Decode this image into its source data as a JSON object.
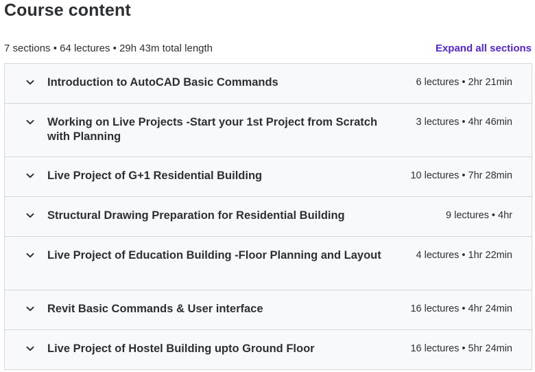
{
  "header": {
    "title": "Course content",
    "summary": "7 sections • 64 lectures • 29h 43m total length",
    "expand_all_label": "Expand all sections"
  },
  "colors": {
    "accent": "#5624d0",
    "section_bg": "#f7f9fa",
    "border": "#d1d7dc",
    "text": "#2d2f31"
  },
  "sections": [
    {
      "title": "Introduction to AutoCAD Basic Commands",
      "meta": "6 lectures • 2hr 21min",
      "icon": "chevron-down-icon"
    },
    {
      "title": "Working on Live Projects -Start your 1st Project from Scratch with Planning",
      "meta": "3 lectures • 4hr 46min",
      "icon": "chevron-down-icon"
    },
    {
      "title": "Live Project of G+1 Residential Building",
      "meta": "10 lectures • 7hr 28min",
      "icon": "chevron-down-icon"
    },
    {
      "title": "Structural Drawing Preparation for Residential Building",
      "meta": "9 lectures • 4hr",
      "icon": "chevron-down-icon"
    },
    {
      "title": "Live Project of Education Building -Floor Planning and Layout",
      "meta": "4 lectures • 1hr 22min",
      "icon": "chevron-down-icon"
    },
    {
      "title": "Revit Basic Commands & User interface",
      "meta": "16 lectures • 4hr 24min",
      "icon": "chevron-down-icon"
    },
    {
      "title": "Live Project of Hostel Building upto Ground Floor",
      "meta": "16 lectures • 5hr 24min",
      "icon": "chevron-down-icon"
    }
  ]
}
